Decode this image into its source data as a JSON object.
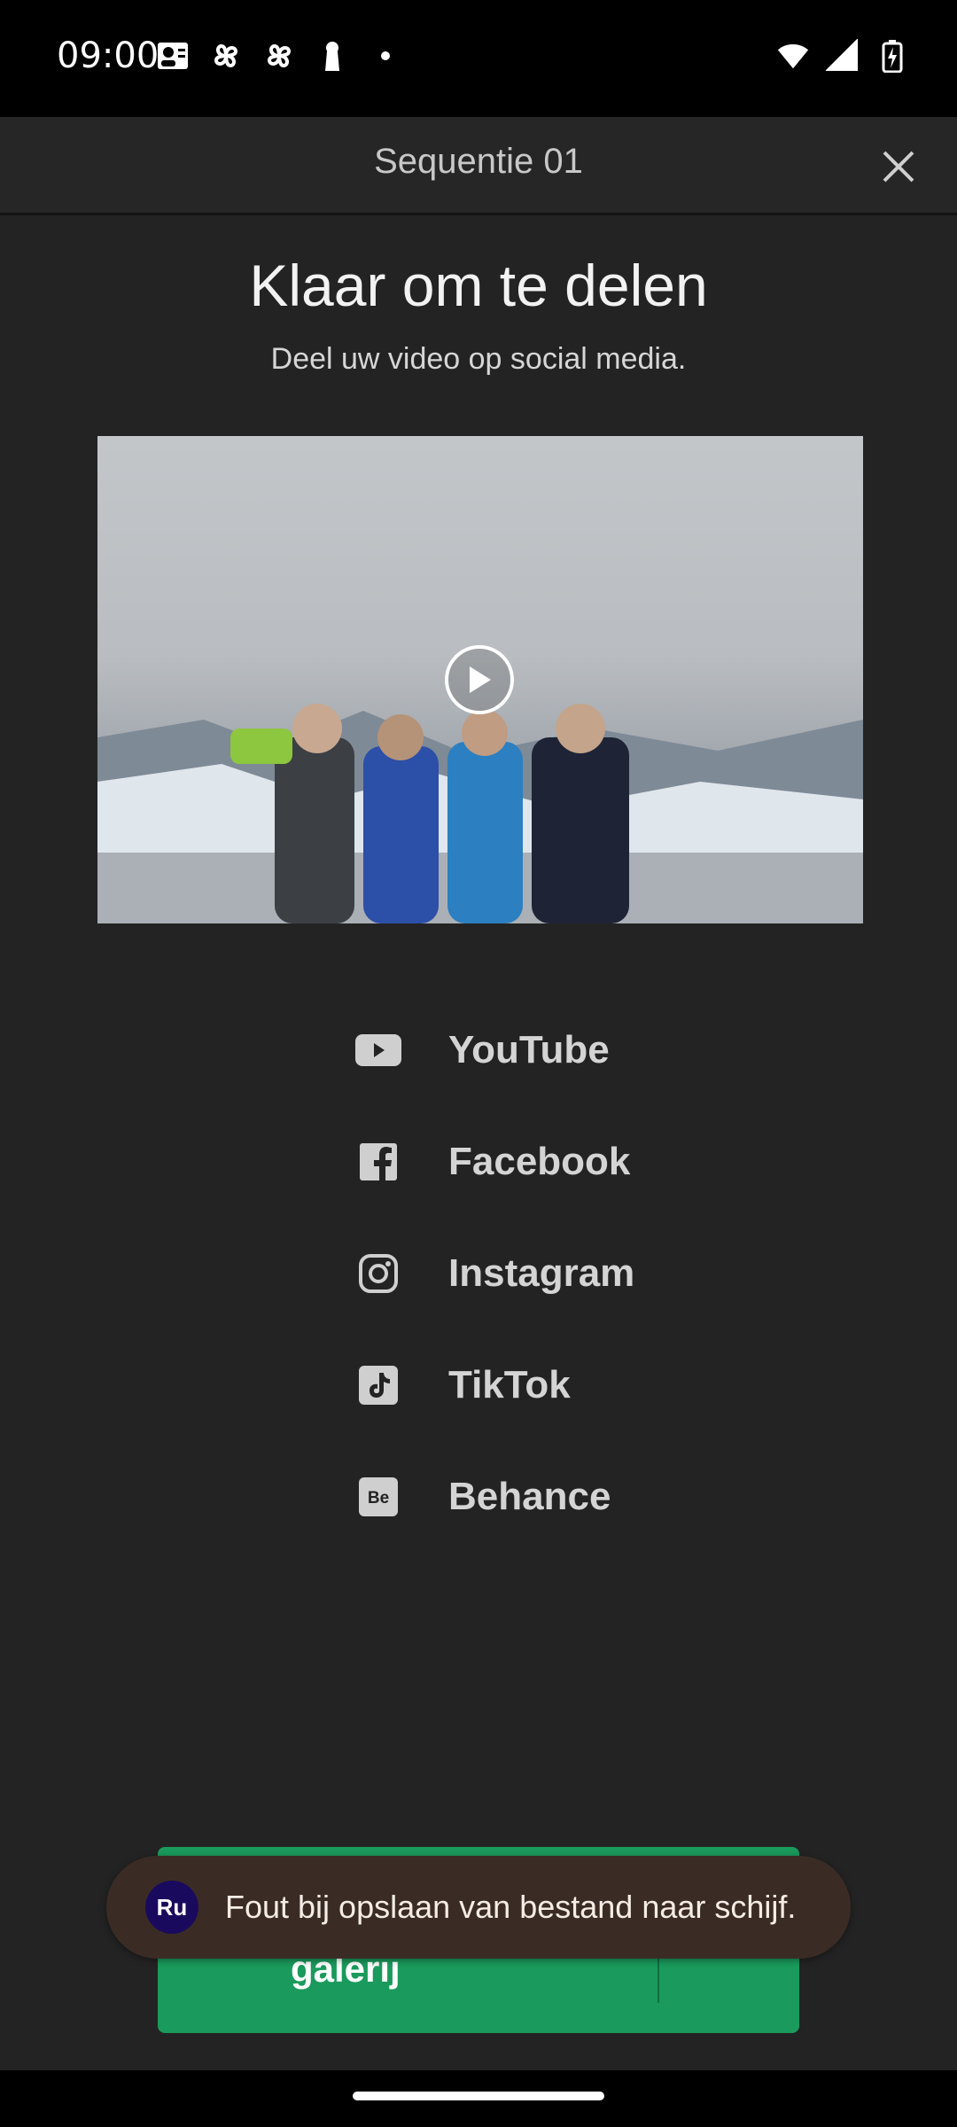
{
  "status_bar": {
    "time": "09:00",
    "left_icons": [
      "portrait-icon",
      "pinwheel-icon",
      "pinwheel-icon",
      "keyhole-icon",
      "dot-icon"
    ],
    "right_icons": [
      "wifi-icon",
      "signal-icon",
      "battery-charging-icon"
    ]
  },
  "header": {
    "title": "Sequentie 01"
  },
  "main": {
    "headline": "Klaar om te delen",
    "subline": "Deel uw video op social media."
  },
  "share_options": [
    {
      "label": "YouTube",
      "icon": "youtube-icon"
    },
    {
      "label": "Facebook",
      "icon": "facebook-icon"
    },
    {
      "label": "Instagram",
      "icon": "instagram-icon"
    },
    {
      "label": "TikTok",
      "icon": "tiktok-icon"
    },
    {
      "label": "Behance",
      "icon": "behance-icon"
    }
  ],
  "save_button": {
    "label": "galerij"
  },
  "toast": {
    "avatar": "Ru",
    "message": "Fout bij opslaan van bestand naar schijf."
  },
  "colors": {
    "accent_green": "#1a9a5c",
    "background": "#232323",
    "toast_bg": "#3a2c25"
  }
}
